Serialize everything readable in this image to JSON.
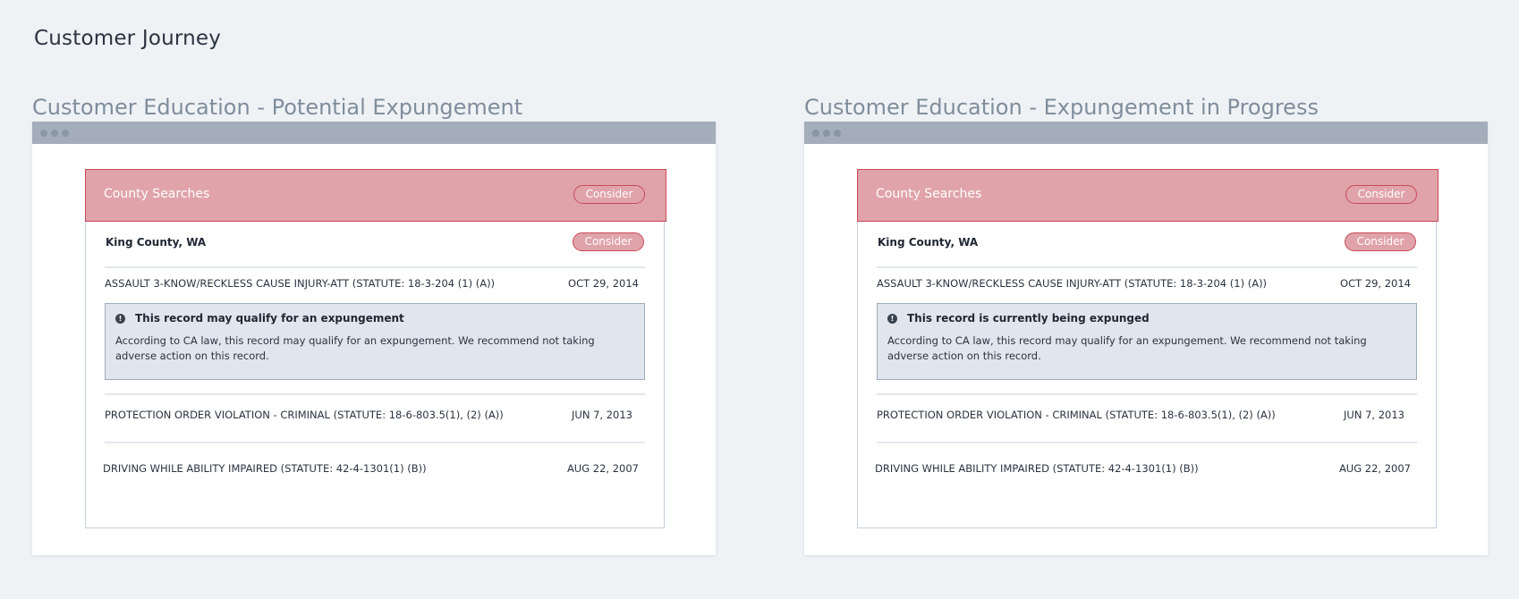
{
  "page": {
    "title": "Customer Journey"
  },
  "panels": [
    {
      "heading": "Customer Education - Potential Expungement",
      "card": {
        "header_title": "County Searches",
        "header_badge": "Consider",
        "county": "King County, WA",
        "county_badge": "Consider",
        "records": [
          {
            "description": "ASSAULT 3-KNOW/RECKLESS CAUSE INJURY-ATT (STATUTE: 18-3-204 (1) (A))",
            "date": "OCT 29, 2014"
          },
          {
            "description": "PROTECTION ORDER VIOLATION - CRIMINAL (STATUTE: 18-6-803.5(1), (2) (A))",
            "date": "JUN 7, 2013"
          },
          {
            "description": "DRIVING WHILE ABILITY IMPAIRED (STATUTE: 42-4-1301(1) (B))",
            "date": "AUG 22, 2007"
          }
        ],
        "notice": {
          "icon": "info-icon",
          "title": "This record may qualify for an expungement",
          "body": "According to CA law, this record may qualify for an expungement. We recommend not taking adverse action on this record."
        }
      }
    },
    {
      "heading": "Customer Education - Expungement in Progress",
      "card": {
        "header_title": "County Searches",
        "header_badge": "Consider",
        "county": "King County, WA",
        "county_badge": "Consider",
        "records": [
          {
            "description": "ASSAULT 3-KNOW/RECKLESS CAUSE INJURY-ATT (STATUTE: 18-3-204 (1) (A))",
            "date": "OCT 29, 2014"
          },
          {
            "description": "PROTECTION ORDER VIOLATION - CRIMINAL (STATUTE: 18-6-803.5(1), (2) (A))",
            "date": "JUN 7, 2013"
          },
          {
            "description": "DRIVING WHILE ABILITY IMPAIRED (STATUTE: 42-4-1301(1) (B))",
            "date": "AUG 22, 2007"
          }
        ],
        "notice": {
          "icon": "info-icon",
          "title": "This record is currently being expunged",
          "body": "According to CA law, this record may qualify for an expungement. We recommend not taking adverse action on this record."
        }
      }
    }
  ],
  "colors": {
    "background": "#eff2f5",
    "window_bar": "#a3aeba",
    "header_fill": "#e0a3aa",
    "consider_red": "#c94a5a",
    "notice_fill": "#e1e6ee",
    "heading_gray": "#7f8d9c"
  }
}
